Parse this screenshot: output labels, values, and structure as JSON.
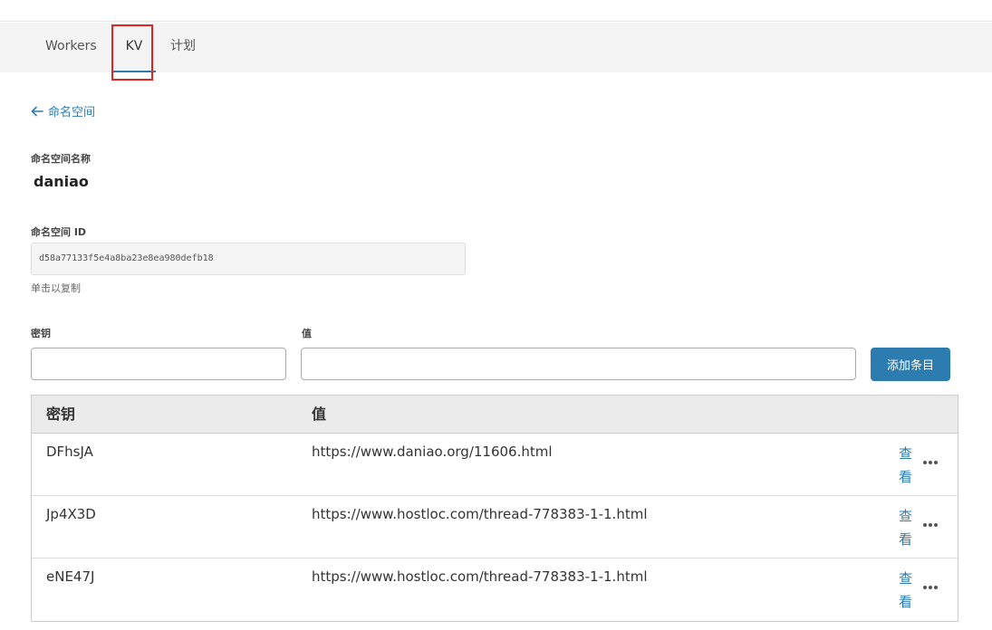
{
  "tabs": [
    {
      "label": "Workers"
    },
    {
      "label": "KV"
    },
    {
      "label": "计划"
    }
  ],
  "back_link": {
    "label": "命名空间"
  },
  "namespace": {
    "name_label": "命名空间名称",
    "name": "daniao",
    "id_label": "命名空间 ID",
    "id": "d58a77133f5e4a8ba23e8ea980defb18",
    "copy_hint": "单击以复制"
  },
  "form": {
    "key_label": "密钥",
    "value_label": "值",
    "key_value": "",
    "value_value": "",
    "add_button": "添加条目"
  },
  "table": {
    "headers": {
      "key": "密钥",
      "value": "值"
    },
    "view_label": "查看",
    "rows": [
      {
        "key": "DFhsJA",
        "value": "https://www.daniao.org/11606.html"
      },
      {
        "key": "Jp4X3D",
        "value": "https://www.hostloc.com/thread-778383-1-1.html"
      },
      {
        "key": "eNE47J",
        "value": "https://www.hostloc.com/thread-778383-1-1.html"
      }
    ]
  },
  "colors": {
    "accent": "#2c7cb0",
    "highlight": "#e02424"
  }
}
